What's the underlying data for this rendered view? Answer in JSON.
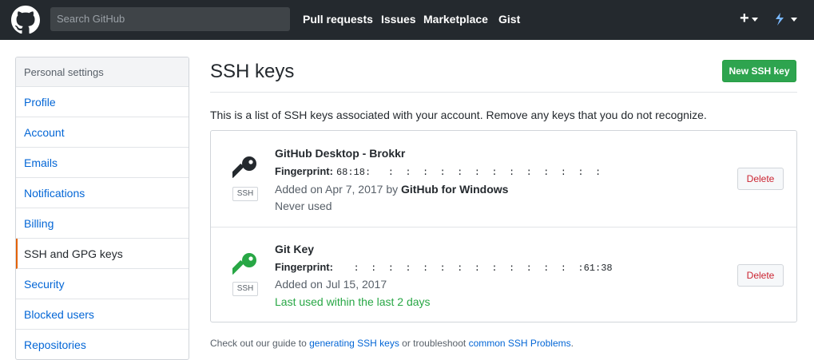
{
  "header": {
    "search_placeholder": "Search GitHub",
    "nav": [
      "Pull requests",
      "Issues",
      "Marketplace",
      "Gist"
    ],
    "plus": "+"
  },
  "sidebar": {
    "heading": "Personal settings",
    "items": [
      {
        "label": "Profile"
      },
      {
        "label": "Account"
      },
      {
        "label": "Emails"
      },
      {
        "label": "Notifications"
      },
      {
        "label": "Billing"
      },
      {
        "label": "SSH and GPG keys",
        "selected": true
      },
      {
        "label": "Security"
      },
      {
        "label": "Blocked users"
      },
      {
        "label": "Repositories"
      }
    ]
  },
  "main": {
    "title": "SSH keys",
    "new_button": "New SSH key",
    "intro": "This is a list of SSH keys associated with your account. Remove any keys that you do not recognize.",
    "keys": [
      {
        "type": "SSH",
        "title": "GitHub Desktop - Brokkr",
        "fingerprint_label": "Fingerprint:",
        "fingerprint": "68:18:   :  :  :  :  :  :  :  :  :  :  :  :  :",
        "added_prefix": "Added on Apr 7, 2017 by",
        "added_by": "GitHub for Windows",
        "last_used": "Never used",
        "icon_color": "#24292e",
        "delete": "Delete"
      },
      {
        "type": "SSH",
        "title": "Git Key",
        "fingerprint_label": "Fingerprint:",
        "fingerprint": "   :  :  :  :  :  :  :  :  :  :  :  :  :  :61:38",
        "added_prefix": "Added on Jul 15, 2017",
        "added_by": "",
        "last_used": "Last used within the last 2 days",
        "icon_color": "#28a745",
        "delete": "Delete"
      }
    ],
    "footer": {
      "prefix": "Check out our guide to",
      "link1": "generating SSH keys",
      "middle": "or troubleshoot",
      "link2": "common SSH Problems",
      "suffix": "."
    }
  },
  "colors": {
    "header_bg": "#24292e",
    "link": "#0366d6",
    "primary_green": "#2ea44f",
    "danger": "#cb2431",
    "selected_marker": "#e36209"
  }
}
